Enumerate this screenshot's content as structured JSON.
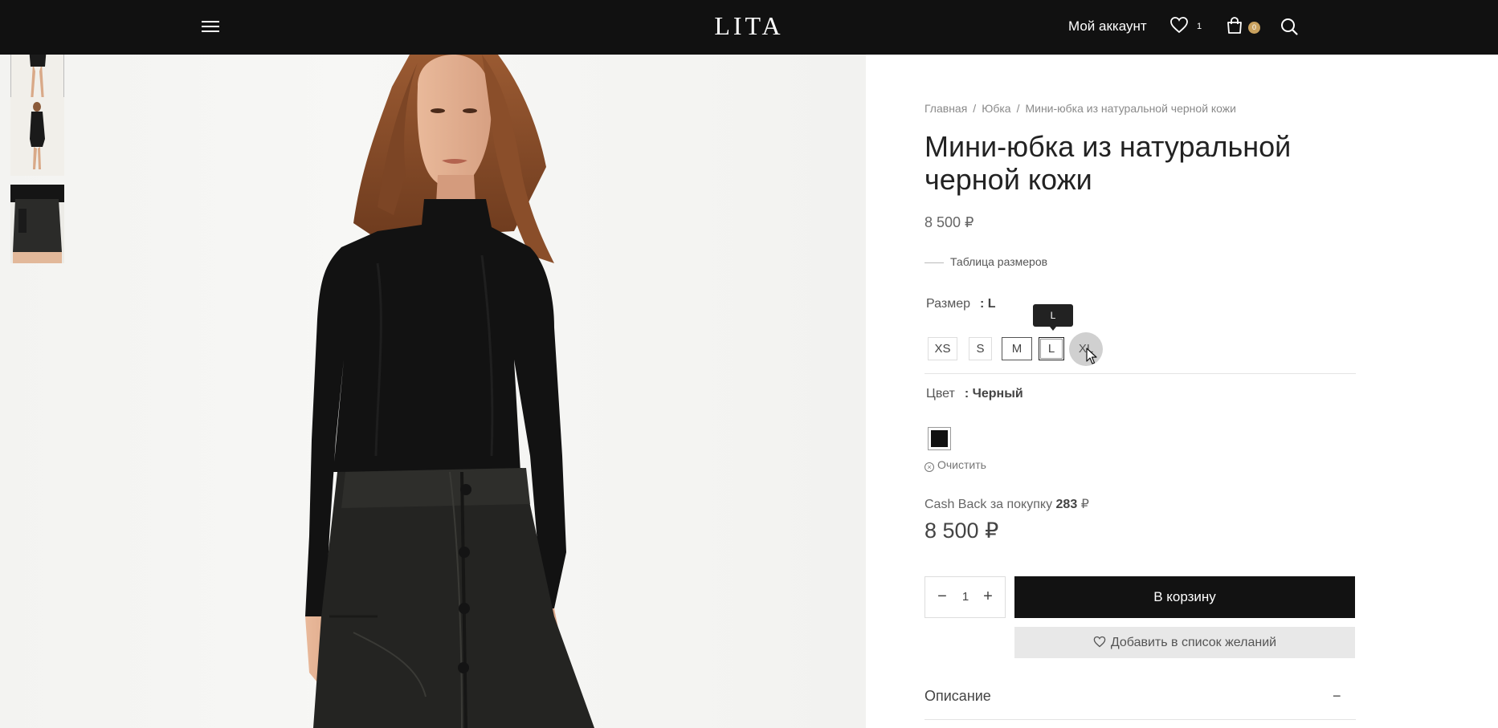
{
  "header": {
    "logo": "LITA",
    "account_label": "Мой аккаунт",
    "wishlist_count": "1",
    "cart_count": "0"
  },
  "breadcrumbs": [
    "Главная",
    "Юбка",
    "Мини-юбка из натуральной черной кожи"
  ],
  "product": {
    "title": "Мини-юбка из натуральной черной кожи",
    "price": "8 500 ₽",
    "size_table_label": "Таблица размеров",
    "size_label": "Размер",
    "size_value": ": L",
    "sizes": [
      "XS",
      "S",
      "M",
      "L",
      "XL"
    ],
    "selected_size": "L",
    "tooltip": "L",
    "color_label": "Цвет",
    "color_value": ": Черный",
    "color_swatch": "#111111",
    "clear_label": "Очистить",
    "cashback_text": "Cash Back за покупку",
    "cashback_amount": "283",
    "cashback_currency": "₽",
    "final_price": "8 500 ₽",
    "quantity": "1",
    "add_to_cart_label": "В корзину",
    "add_to_wishlist_label": "Добавить в список желаний",
    "description_label": "Описание",
    "description_toggle": "−"
  },
  "colors": {
    "header_bg": "#111111",
    "cart_badge": "#c9a15e",
    "primary_button": "#121212"
  }
}
